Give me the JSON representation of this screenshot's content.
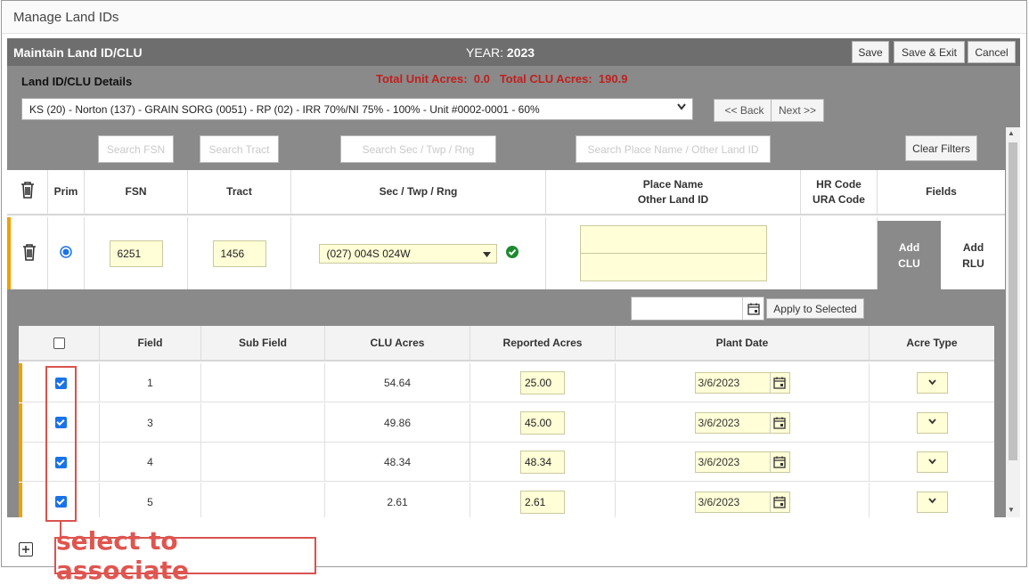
{
  "dialog": {
    "title": "Manage Land IDs"
  },
  "header": {
    "title": "Maintain Land ID/CLU",
    "year_label": "YEAR:",
    "year_value": "2023",
    "save_label": "Save",
    "save_exit_label": "Save & Exit",
    "cancel_label": "Cancel"
  },
  "details": {
    "label": "Land ID/CLU Details",
    "totals": "Total Unit Acres:  0.0   Total CLU Acres:  190.9",
    "land_select_value": "KS (20) - Norton (137) - GRAIN SORG (0051) - RP (02) - IRR 70%/NI 75% - 100% - Unit #0002-0001 - 60%",
    "back_label": "<< Back",
    "next_label": "Next >>"
  },
  "filters": {
    "fsn_placeholder": "Search FSN",
    "tract_placeholder": "Search Tract",
    "sec_placeholder": "Search Sec / Twp / Rng",
    "place_placeholder": "Search Place Name / Other Land ID",
    "clear_label": "Clear Filters"
  },
  "land_table": {
    "headers": {
      "prim": "Prim",
      "fsn": "FSN",
      "tract": "Tract",
      "sec": "Sec / Twp / Rng",
      "place_line1": "Place Name",
      "place_line2": "Other Land ID",
      "hr_line1": "HR Code",
      "hr_line2": "URA Code",
      "fields": "Fields"
    },
    "row": {
      "fsn": "6251",
      "tract": "1456",
      "sec": "(027) 004S 024W",
      "add_clu_line1": "Add",
      "add_clu_line2": "CLU",
      "add_rlu_line1": "Add",
      "add_rlu_line2": "RLU"
    }
  },
  "apply": {
    "label": "Apply to Selected"
  },
  "fields_table": {
    "headers": {
      "field": "Field",
      "sub_field": "Sub Field",
      "clu_acres": "CLU Acres",
      "reported_acres": "Reported Acres",
      "plant_date": "Plant Date",
      "acre_type": "Acre Type"
    },
    "rows": [
      {
        "field": "1",
        "clu_acres": "54.64",
        "reported_acres": "25.00",
        "plant_date": "3/6/2023"
      },
      {
        "field": "3",
        "clu_acres": "49.86",
        "reported_acres": "45.00",
        "plant_date": "3/6/2023"
      },
      {
        "field": "4",
        "clu_acres": "48.34",
        "reported_acres": "48.34",
        "plant_date": "3/6/2023"
      },
      {
        "field": "5",
        "clu_acres": "2.61",
        "reported_acres": "2.61",
        "plant_date": "3/6/2023"
      }
    ]
  },
  "annotation": {
    "label": "select to associate"
  },
  "colors": {
    "accent": "#f0a000",
    "header_bg": "#6e6e6e",
    "panel_bg": "#8a8a8a",
    "totals": "#c0201e",
    "annotation": "#d9534f"
  }
}
